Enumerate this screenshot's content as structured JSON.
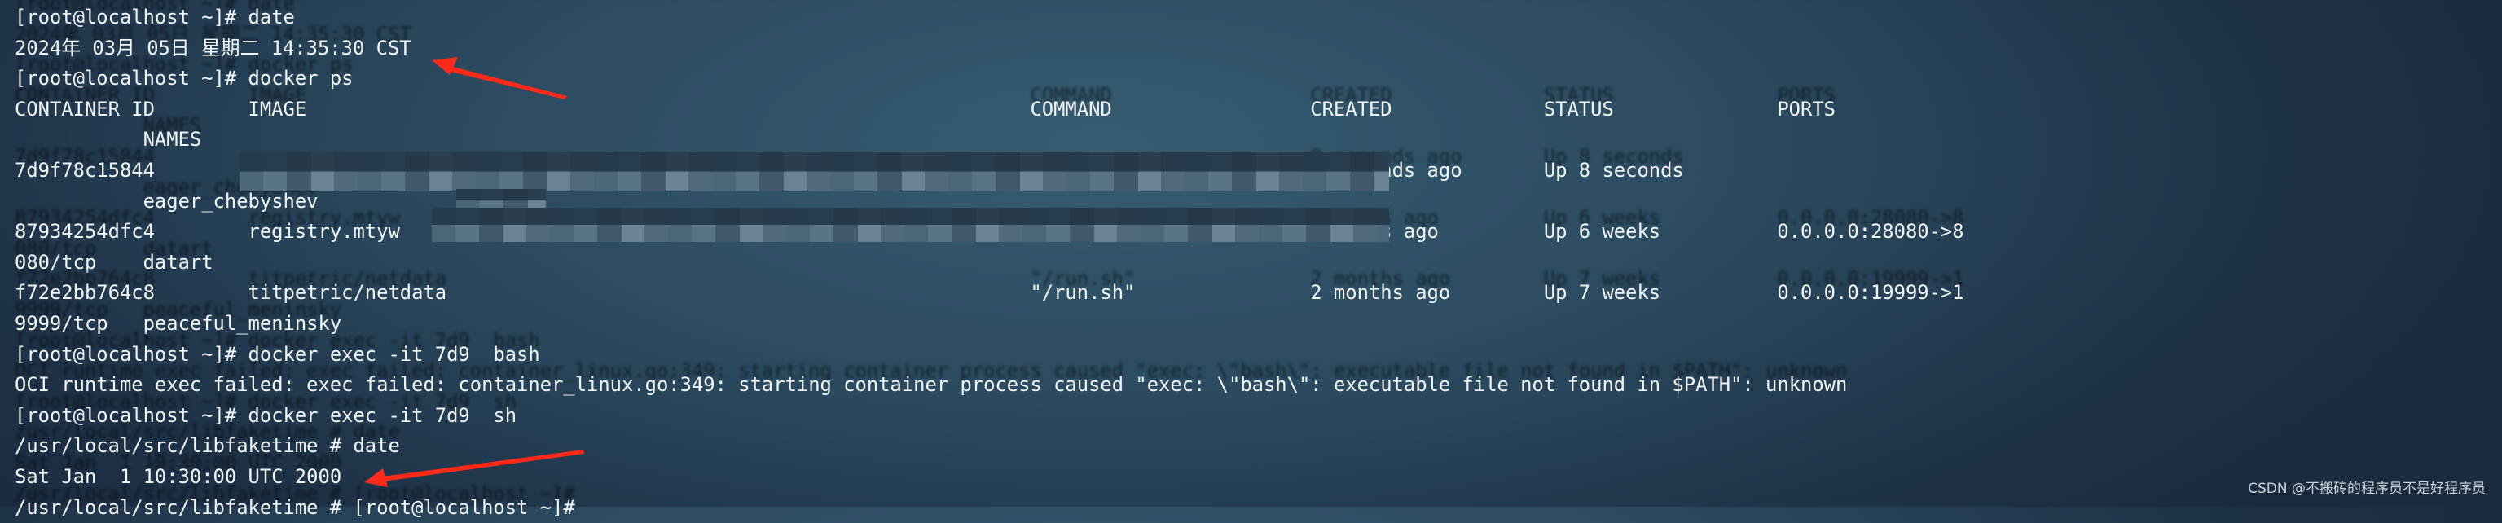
{
  "terminal": {
    "lines": [
      {
        "type": "text",
        "text": "[root@localhost ~]# date"
      },
      {
        "type": "text",
        "text": "2024年 03月 05日 星期二 14:35:30 CST"
      },
      {
        "type": "text",
        "text": "[root@localhost ~]# docker ps"
      },
      {
        "type": "header",
        "cols": [
          "CONTAINER ID",
          "IMAGE",
          "COMMAND",
          "CREATED",
          "STATUS",
          "PORTS"
        ]
      },
      {
        "type": "names",
        "text": "NAMES"
      },
      {
        "type": "row",
        "cols": [
          "7d9f78c15844",
          "",
          "",
          "8 seconds ago",
          "Up 8 seconds",
          ""
        ]
      },
      {
        "type": "names",
        "text": "eager_chebyshev"
      },
      {
        "type": "row",
        "cols": [
          "87934254dfc4",
          "registry.mtyw",
          "\"/bin/sh -c 'java -jar…\"",
          "6 weeks ago",
          "Up 6 weeks",
          "0.0.0.0:28080->8"
        ]
      },
      {
        "type": "wrap",
        "port": "080/tcp",
        "name": "datart"
      },
      {
        "type": "row",
        "cols": [
          "f72e2bb764c8",
          "titpetric/netdata",
          "\"/run.sh\"",
          "2 months ago",
          "Up 7 weeks",
          "0.0.0.0:19999->1"
        ]
      },
      {
        "type": "wrap",
        "port": "9999/tcp",
        "name": "peaceful_meninsky"
      },
      {
        "type": "text",
        "text": "[root@localhost ~]# docker exec -it 7d9  bash"
      },
      {
        "type": "text",
        "text": "OCI runtime exec failed: exec failed: container_linux.go:349: starting container process caused \"exec: \\\"bash\\\": executable file not found in $PATH\": unknown"
      },
      {
        "type": "text",
        "text": "[root@localhost ~]# docker exec -it 7d9  sh"
      },
      {
        "type": "text",
        "text": "/usr/local/src/libfaketime # date"
      },
      {
        "type": "text",
        "text": "Sat Jan  1 10:30:00 UTC 2000"
      },
      {
        "type": "text",
        "text": "/usr/local/src/libfaketime # [root@localhost ~]#"
      }
    ]
  },
  "watermark": "CSDN @不搬砖的程序员不是好程序员",
  "colors": {
    "background": "#2b4a5f",
    "text": "#f2f5f7",
    "arrow": "#ff2a1a"
  }
}
